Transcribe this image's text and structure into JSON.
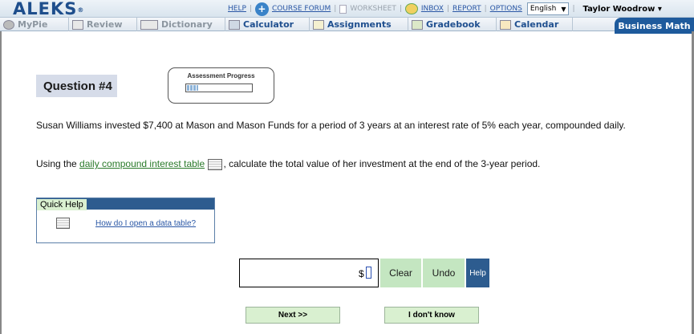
{
  "header": {
    "logo": "ALEKS",
    "logo_mark": "®",
    "links": {
      "help": "HELP",
      "course_forum": "COURSE FORUM",
      "worksheet": "WORKSHEET",
      "inbox": "INBOX",
      "report": "REPORT",
      "options": "OPTIONS"
    },
    "language": "English",
    "user": "Taylor Woodrow"
  },
  "tabs": [
    {
      "label": "MyPie",
      "enabled": false,
      "icon": "pie-icon"
    },
    {
      "label": "Review",
      "enabled": false,
      "icon": "check-icon"
    },
    {
      "label": "Dictionary",
      "enabled": false,
      "icon": "book-icon"
    },
    {
      "label": "Calculator",
      "enabled": true,
      "icon": "calculator-icon"
    },
    {
      "label": "Assignments",
      "enabled": true,
      "icon": "pencil-icon"
    },
    {
      "label": "Gradebook",
      "enabled": true,
      "icon": "gradebook-icon"
    },
    {
      "label": "Calendar",
      "enabled": true,
      "icon": "calendar-icon"
    }
  ],
  "course": "Business Math",
  "question": {
    "title": "Question #4",
    "progress_label": "Assessment Progress",
    "progress_fraction": 0.17,
    "text1": "Susan Williams invested $7,400 at Mason and Mason Funds for a period of 3 years at an interest rate of 5% each year, compounded daily.",
    "text2_prefix": "Using the ",
    "text2_link": "daily compound interest table",
    "text2_suffix": ", calculate the total value of her investment at the end of the 3-year period."
  },
  "quick_help": {
    "title": "Quick Help",
    "link": "How do I open a data table?"
  },
  "answer": {
    "currency": "$",
    "value": ""
  },
  "buttons": {
    "clear": "Clear",
    "undo": "Undo",
    "help": "Help",
    "next": "Next >>",
    "dont_know": "I don't know"
  }
}
